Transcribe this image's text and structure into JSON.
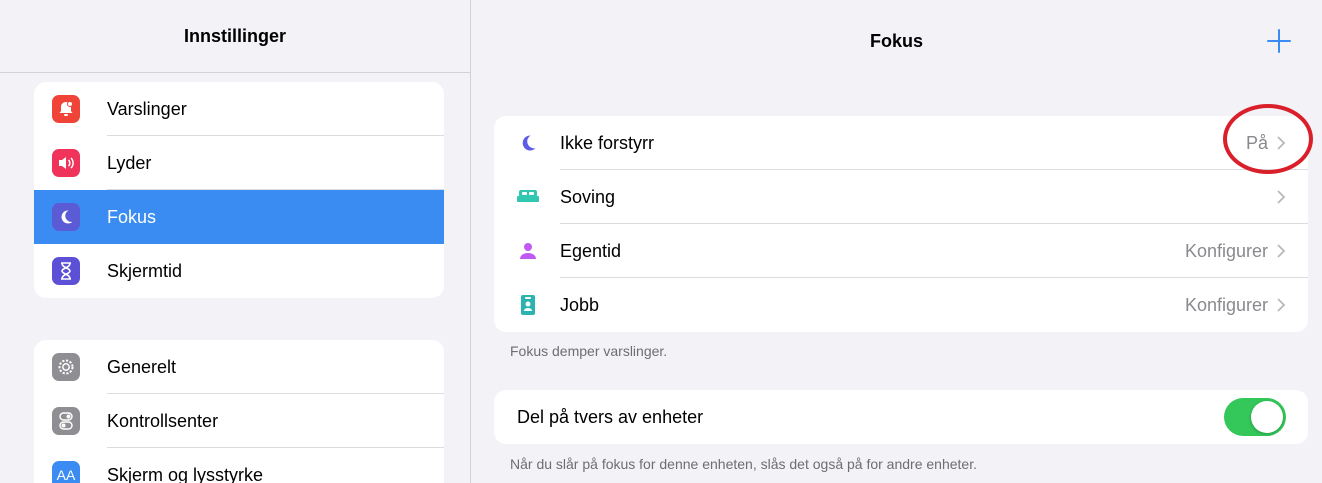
{
  "sidebar": {
    "title": "Innstillinger",
    "group1": [
      {
        "label": "Varslinger",
        "icon": "bell-icon",
        "color": "#f04438"
      },
      {
        "label": "Lyder",
        "icon": "speaker-icon",
        "color": "#f0335a"
      },
      {
        "label": "Fokus",
        "icon": "moon-icon",
        "color": "#5b5bd6"
      },
      {
        "label": "Skjermtid",
        "icon": "hourglass-icon",
        "color": "#5b50d6"
      }
    ],
    "group2": [
      {
        "label": "Generelt",
        "icon": "gear-icon",
        "color": "#8e8e93"
      },
      {
        "label": "Kontrollsenter",
        "icon": "switches-icon",
        "color": "#8e8e93"
      },
      {
        "label": "Skjerm og lysstyrke",
        "icon": "text-size-icon",
        "color": "#3a8cf2",
        "icon_text": "AA"
      }
    ],
    "selected": "Fokus"
  },
  "main": {
    "title": "Fokus",
    "add_icon": "plus-icon",
    "focus_modes": [
      {
        "label": "Ikke forstyrr",
        "value": "På",
        "icon": "moon-icon",
        "color": "#5e5ce6"
      },
      {
        "label": "Soving",
        "value": "",
        "icon": "bed-icon",
        "color": "#30c8b0"
      },
      {
        "label": "Egentid",
        "value": "Konfigurer",
        "icon": "person-icon",
        "color": "#bf5af2"
      },
      {
        "label": "Jobb",
        "value": "Konfigurer",
        "icon": "badge-icon",
        "color": "#2bb3b0"
      }
    ],
    "focus_footnote": "Fokus demper varslinger.",
    "share": {
      "label": "Del på tvers av enheter",
      "enabled": true
    },
    "share_footnote": "Når du slår på fokus for denne enheten, slås det også på for andre enheter."
  },
  "colors": {
    "accent": "#3a8cf2",
    "toggle_on": "#34c759",
    "annotation": "#d9202a"
  }
}
